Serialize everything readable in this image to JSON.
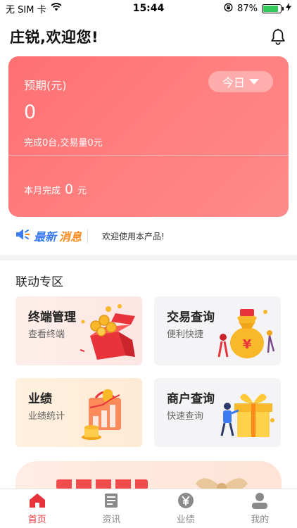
{
  "status_bar": {
    "carrier": "无 SIM 卡",
    "time": "15:44",
    "battery": "87%",
    "battery_level": 0.87
  },
  "header": {
    "greeting": "庄锐,欢迎您!"
  },
  "stats": {
    "label": "预期(元)",
    "period": "今日",
    "value": "0",
    "summary": "完成0台,交易量0元",
    "month_label": "本月完成",
    "month_value": "0",
    "month_unit": "元"
  },
  "news": {
    "brand_part1": "最新",
    "brand_part2": "消息",
    "text": "欢迎使用本产品!"
  },
  "linkage": {
    "title": "联动专区",
    "tiles": [
      {
        "title": "终端管理",
        "subtitle": "查看终端"
      },
      {
        "title": "交易查询",
        "subtitle": "便利快捷"
      },
      {
        "title": "业绩",
        "subtitle": "业绩统计"
      },
      {
        "title": "商户查询",
        "subtitle": "快速查询"
      }
    ]
  },
  "tabs": [
    {
      "label": "首页",
      "icon": "home-icon",
      "active": true
    },
    {
      "label": "资讯",
      "icon": "news-icon",
      "active": false
    },
    {
      "label": "业绩",
      "icon": "yuan-icon",
      "active": false
    },
    {
      "label": "我的",
      "icon": "user-icon",
      "active": false
    }
  ],
  "colors": {
    "accent": "#e8333a",
    "card_start": "#ff6f72",
    "card_end": "#ff8a8a",
    "news_blue": "#3b7cf0",
    "news_orange": "#ff8a1c"
  }
}
